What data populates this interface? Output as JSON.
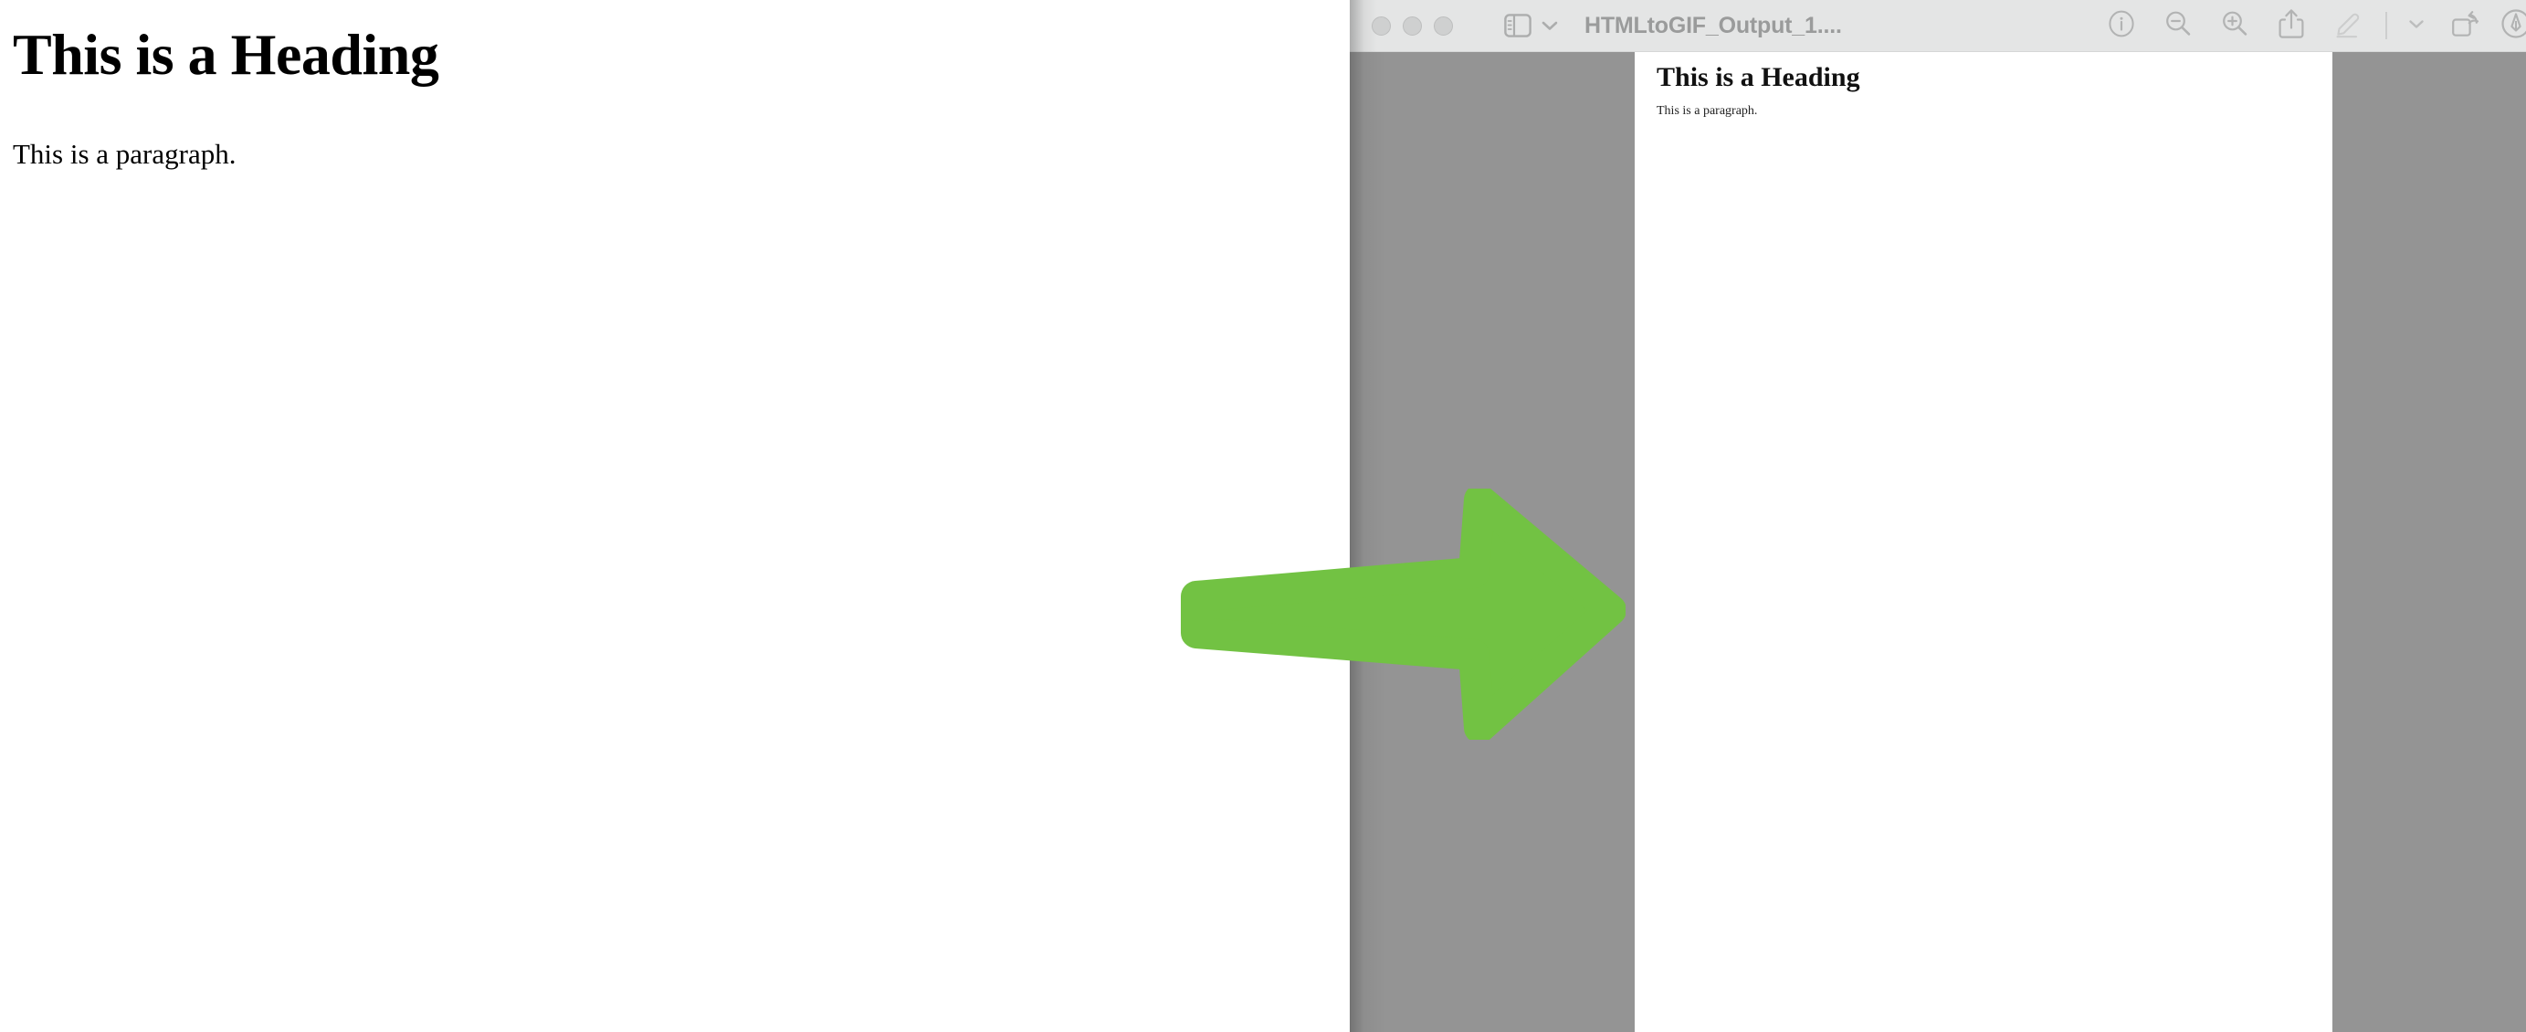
{
  "source_page": {
    "heading": "This is a Heading",
    "paragraph": "This is a paragraph."
  },
  "preview_window": {
    "title": "HTMLtoGIF_Output_1....",
    "traffic_lights": [
      {
        "name": "close",
        "color": "#cfd0d0"
      },
      {
        "name": "minimize",
        "color": "#cfd0d0"
      },
      {
        "name": "maximize",
        "color": "#cfd0d0"
      }
    ],
    "sidebar_toggle": {
      "icon": "sidebar-icon",
      "dropdown_icon": "chevron-down-icon"
    },
    "toolbar": [
      {
        "name": "info-icon",
        "label": "Info",
        "enabled": true
      },
      {
        "name": "zoom-out-icon",
        "label": "Zoom Out",
        "enabled": true
      },
      {
        "name": "zoom-in-icon",
        "label": "Zoom In",
        "enabled": true
      },
      {
        "name": "share-icon",
        "label": "Share",
        "enabled": true
      },
      {
        "name": "markup-pen-icon",
        "label": "Markup",
        "enabled": false
      },
      {
        "name": "chevron-down-icon",
        "label": "More",
        "enabled": true
      },
      {
        "name": "rotate-left-icon",
        "label": "Rotate Left",
        "enabled": true
      },
      {
        "name": "annotate-circle-icon",
        "label": "Annotate",
        "enabled": true
      }
    ],
    "document": {
      "heading": "This is a Heading",
      "paragraph": "This is a paragraph."
    },
    "colors": {
      "toolbar_background": "#e4e5e5",
      "canvas_background": "#949494",
      "page_background": "#ffffff",
      "title_text": "#9a9b9b",
      "icon": "#b2b3b3"
    }
  },
  "annotation": {
    "arrow": {
      "name": "green-arrow",
      "direction": "right",
      "color": "#72c243"
    }
  }
}
